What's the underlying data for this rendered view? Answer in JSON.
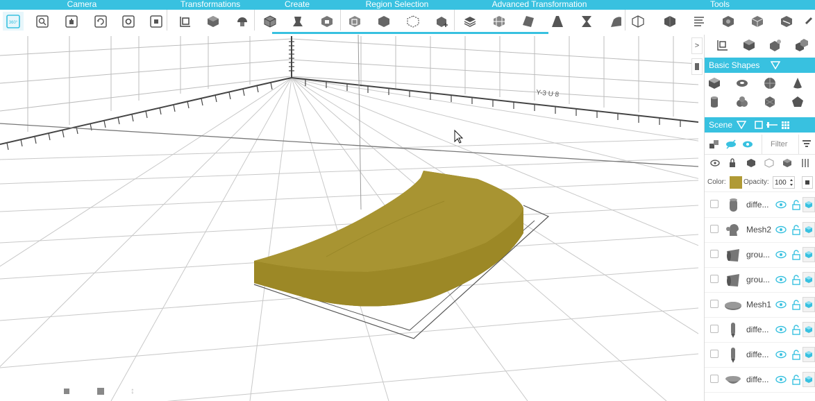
{
  "toolbar": {
    "groups": [
      "Camera",
      "Transformations",
      "Create",
      "Region Selection",
      "Advanced Transformation",
      "Tools"
    ],
    "home_badge": "360°"
  },
  "viewport": {
    "axis_label": "Y-3 U 8",
    "nav_glyph": "↕"
  },
  "right_panel": {
    "collapse_glyph": ">",
    "basic_shapes_title": "Basic Shapes",
    "scene_title": "Scene",
    "filter_placeholder": "Filter",
    "color_label": "Color:",
    "color_value": "#b09a35",
    "opacity_label": "Opacity:",
    "opacity_value": "100",
    "scene_items": [
      {
        "name": "diffe...",
        "icon": "cylinder-icon"
      },
      {
        "name": "Mesh2",
        "icon": "head-mesh-icon"
      },
      {
        "name": "grou...",
        "icon": "cone-cup-icon"
      },
      {
        "name": "grou...",
        "icon": "cone-cup-icon"
      },
      {
        "name": "Mesh1",
        "icon": "flat-disc-icon"
      },
      {
        "name": "diffe...",
        "icon": "pen-icon"
      },
      {
        "name": "diffe...",
        "icon": "pen-icon"
      },
      {
        "name": "diffe...",
        "icon": "bowl-icon"
      }
    ]
  },
  "colors": {
    "accent": "#38c1e0",
    "model": "#a89432"
  }
}
